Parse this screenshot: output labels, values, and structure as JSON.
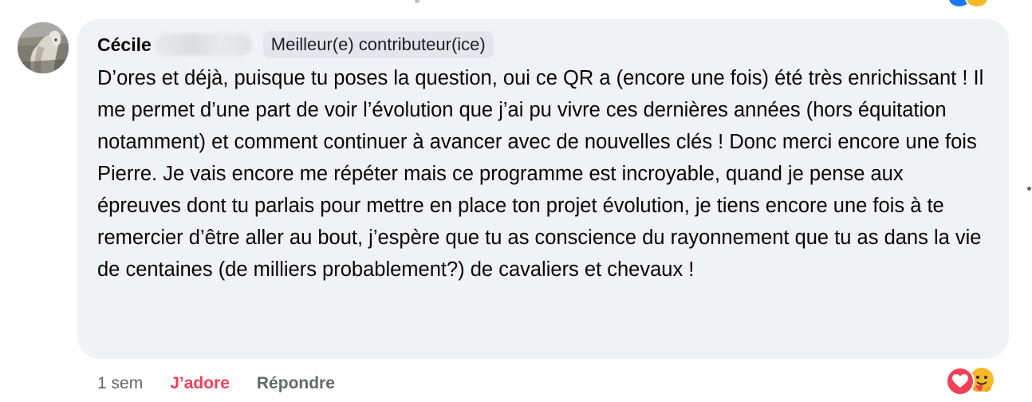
{
  "comment": {
    "author_first_name": "Cécile",
    "author_badge": "Meilleur(e) contributeur(ice)",
    "text": "D’ores et déjà, puisque tu poses la question, oui ce QR a (encore une fois) été très enrichissant ! Il me permet d’une part de voir l’évolution que j’ai pu vivre ces dernières années (hors équitation notamment) et comment continuer à avancer avec de nouvelles clés ! Donc merci encore une fois Pierre. Je vais encore me répéter mais ce programme est incroyable, quand je pense aux épreuves dont tu parlais pour mettre en place ton projet évolution, je tiens encore une fois à te remercier d’être aller au bout, j’espère que tu as conscience du rayonnement que tu as dans la vie de centaines (de milliers probablement?) de cavaliers et chevaux !"
  },
  "actions": {
    "timestamp": "1 sem",
    "love_label": "J’adore",
    "reply_label": "Répondre"
  },
  "reactions": {
    "icons": [
      "heart-icon",
      "care-emoji-icon"
    ]
  },
  "colors": {
    "bubble_background": "#f0f2f5",
    "love_red": "#f33e58",
    "secondary_text": "#65676b",
    "badge_background": "#e4e6eb"
  }
}
